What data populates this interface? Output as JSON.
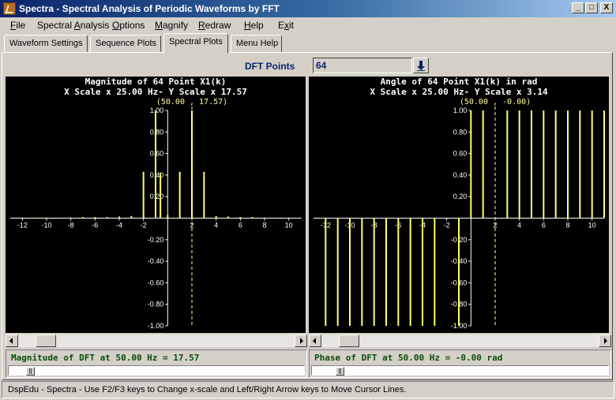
{
  "window": {
    "title": "Spectra - Spectral Analysis of Periodic Waveforms by FFT",
    "icon": "spectra-app-icon",
    "controls": [
      "_",
      "□",
      "X"
    ]
  },
  "menu": [
    {
      "pre": "",
      "key": "F",
      "post": "ile"
    },
    {
      "pre": "Spectral ",
      "key": "A",
      "post": "nalysis"
    },
    {
      "pre": "",
      "key": "O",
      "post": "ptions"
    },
    {
      "pre": "",
      "key": "M",
      "post": "agnify"
    },
    {
      "pre": "",
      "key": "R",
      "post": "edraw"
    },
    {
      "pre": "",
      "key": "H",
      "post": "elp"
    },
    {
      "pre": "E",
      "key": "x",
      "post": "it"
    }
  ],
  "tabs": [
    "Waveform Settings",
    "Sequence Plots",
    "Spectral Plots",
    "Menu Help"
  ],
  "active_tab": "Spectral Plots",
  "dft": {
    "label": "DFT Points",
    "value": "64"
  },
  "chart_data": [
    {
      "type": "bar",
      "title": "Magnitude of 64 Point X1(k)",
      "subtitle": "X Scale x 25.00 Hz- Y Scale x   17.57",
      "cursor_label": "(50.00 , 17.57)",
      "cursor_x": 2,
      "x_ticks": [
        -12,
        -10,
        -8,
        -6,
        -4,
        -2,
        2,
        4,
        6,
        8,
        10
      ],
      "y_ticks": [
        "1.00",
        "0.80",
        "0.60",
        "0.40",
        "0.20",
        "-0.20",
        "-0.40",
        "-0.60",
        "-0.80",
        "-1.00"
      ],
      "xlim": [
        -13,
        11
      ],
      "ylim": [
        -1,
        1
      ],
      "grid": false,
      "x": [
        -12,
        -11,
        -10,
        -9,
        -8,
        -7,
        -6,
        -5,
        -4,
        -3,
        -2,
        -1,
        0,
        1,
        2,
        3,
        4,
        5,
        6,
        7,
        8,
        9,
        10,
        11
      ],
      "values": [
        0.005,
        0.005,
        0.005,
        0.005,
        0.005,
        0.01,
        0.01,
        0.01,
        0.015,
        0.02,
        0.43,
        1.0,
        0.03,
        0.43,
        1.0,
        0.43,
        0.02,
        0.015,
        0.01,
        0.01,
        0.005,
        0.005,
        0.005,
        0.005
      ],
      "extra_bars": [
        {
          "x": -0.6,
          "value": 0.42
        }
      ]
    },
    {
      "type": "bar",
      "title": "Angle of 64 Point X1(k) in rad",
      "subtitle": "X Scale x 25.00 Hz- Y Scale x    3.14",
      "cursor_label": "(50.00 , -0.00)",
      "cursor_x": 2,
      "x_ticks": [
        -12,
        -10,
        -8,
        -6,
        -4,
        -2,
        2,
        4,
        6,
        8,
        10
      ],
      "y_ticks": [
        "1.00",
        "0.80",
        "0.60",
        "0.40",
        "0.20",
        "-0.20",
        "-0.40",
        "-0.60",
        "-0.80",
        "-1.00"
      ],
      "xlim": [
        -13,
        11
      ],
      "ylim": [
        -1,
        1
      ],
      "grid": false,
      "x": [
        -12,
        -11,
        -10,
        -9,
        -8,
        -7,
        -6,
        -5,
        -4,
        -3,
        -2,
        -1,
        0,
        1,
        2,
        3,
        4,
        5,
        6,
        7,
        8,
        9,
        10,
        11
      ],
      "values": [
        -1,
        -1,
        -1,
        -1,
        -1,
        -1,
        -1,
        -1,
        -1,
        -1,
        0,
        -1,
        1,
        1,
        0,
        1,
        1,
        1,
        1,
        1,
        1,
        1,
        1,
        1
      ]
    }
  ],
  "readouts": {
    "left": "Magnitude of DFT at 50.00 Hz = 17.57",
    "right": "Phase of DFT at 50.00 Hz = -0.00 rad"
  },
  "slider_positions": {
    "left": 0.06,
    "right": 0.08
  },
  "status": "DspEdu - Spectra - Use F2/F3 keys to Change x-scale and Left/Right Arrow keys to Move Cursor Lines.",
  "colors": {
    "plot_bg": "#000000",
    "bars": "#ffff66",
    "axis": "#ffffff",
    "cursor": "#ffff99",
    "readout": "#0b4d0b"
  }
}
